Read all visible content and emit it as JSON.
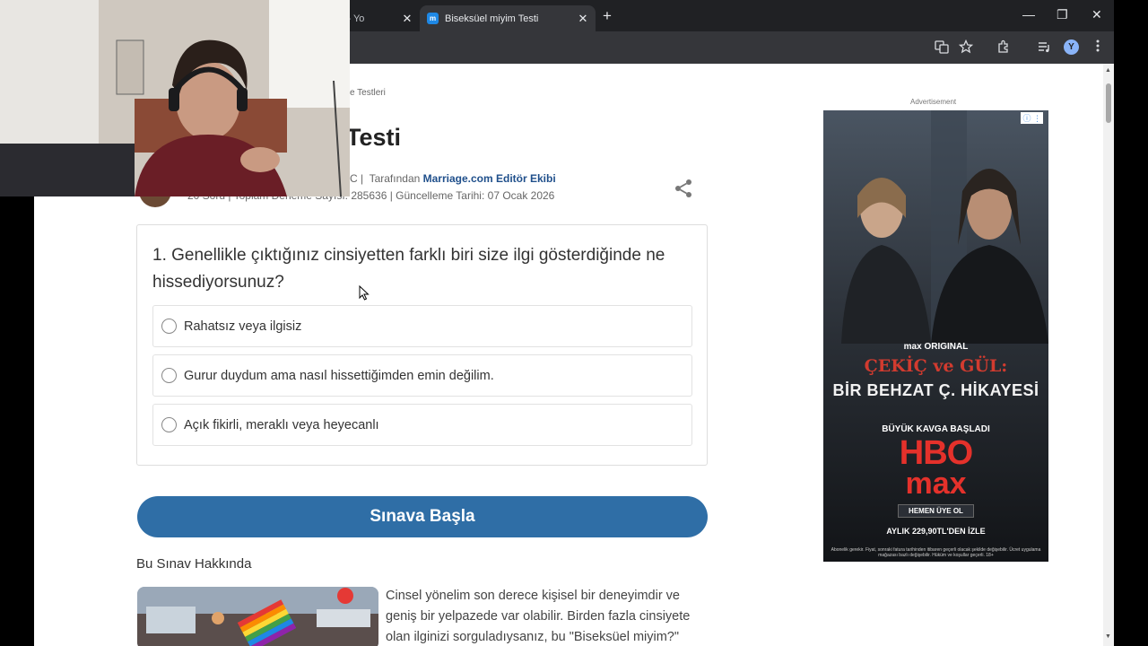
{
  "browser": {
    "inactive_tab_title": "ıfakası - Yo",
    "active_tab_title": "Biseksüel miyim Testi",
    "favicon_letter": "m",
    "tab_close": "✕",
    "new_tab": "+",
    "minimize": "—",
    "restore": "❐",
    "close": "✕",
    "profile_initial": "Y"
  },
  "page": {
    "breadcrumb": "e Testleri",
    "title": "Testi",
    "meta_prefix": "C |",
    "meta_by": "Tarafından",
    "meta_author": "Marriage.com Editör Ekibi",
    "meta_stats": "20 Soru | Toplam Deneme Sayısı: 285636 | Güncelleme Tarihi: 07 Ocak 2026"
  },
  "quiz": {
    "question": "1. Genellikle çıktığınız cinsiyetten farklı biri size ilgi gösterdiğinde ne hissediyorsunuz?",
    "options": [
      "Rahatsız veya ilgisiz",
      "Gurur duydum ama nasıl hissettiğimden emin değilim.",
      "Açık fikirli, meraklı veya heyecanlı"
    ],
    "start_button": "Sınava Başla"
  },
  "about": {
    "heading": "Bu Sınav Hakkında",
    "text": "Cinsel yönelim son derece kişisel bir deneyimdir ve geniş bir yelpazede var olabilir. Birden fazla cinsiyete olan ilginizi sorguladıysanız, bu \"Biseksüel miyim?\""
  },
  "ad": {
    "label": "Advertisement",
    "badge": "ⓘ ⋮",
    "brand_small": "max ORIGINAL",
    "title_line1": "ÇEKİÇ ve GÜL:",
    "title_line2": "BİR BEHZAT Ç. HİKAYESİ",
    "subtitle": "BÜYÜK KAVGA BAŞLADI",
    "hbo": "HBO",
    "max": "max",
    "cta": "HEMEN ÜYE OL",
    "price": "AYLIK 229,90TL'DEN İZLE",
    "fine_print": "Abonelik gerekir. Fiyat, sonraki fatura tarihinden itibaren geçerli olacak şekilde değişebilir. Ücret uygulama mağazası bazlı değişebilir. Hüküm ve koşullar geçerli. 18+"
  }
}
